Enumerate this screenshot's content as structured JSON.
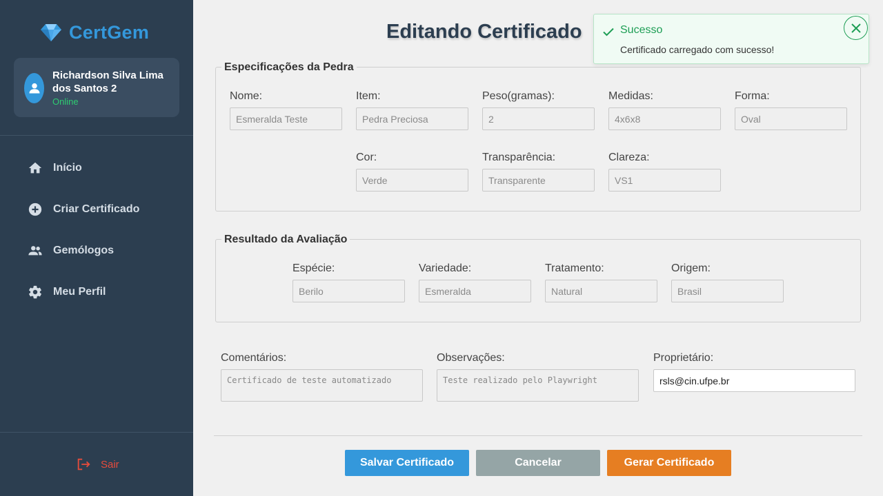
{
  "app": {
    "brand": "CertGem",
    "brand_icon": "gem-icon"
  },
  "user": {
    "name": "Richardson Silva Lima dos Santos 2",
    "status": "Online"
  },
  "nav": [
    {
      "label": "Início",
      "icon": "home-icon"
    },
    {
      "label": "Criar Certificado",
      "icon": "plus-circle-icon"
    },
    {
      "label": "Gemólogos",
      "icon": "people-icon"
    },
    {
      "label": "Meu Perfil",
      "icon": "gear-icon"
    }
  ],
  "logout": {
    "label": "Sair",
    "icon": "logout-icon"
  },
  "page": {
    "title": "Editando Certificado"
  },
  "stone": {
    "legend": "Especificações da Pedra",
    "fields": [
      {
        "label": "Nome:",
        "value": "Esmeralda Teste"
      },
      {
        "label": "Item:",
        "value": "Pedra Preciosa"
      },
      {
        "label": "Peso(gramas):",
        "value": "2"
      },
      {
        "label": "Medidas:",
        "value": "4x6x8"
      },
      {
        "label": "Forma:",
        "value": "Oval"
      },
      {
        "label": "Cor:",
        "value": "Verde"
      },
      {
        "label": "Transparência:",
        "value": "Transparente"
      },
      {
        "label": "Clareza:",
        "value": "VS1"
      }
    ]
  },
  "result": {
    "legend": "Resultado da Avaliação",
    "fields": [
      {
        "label": "Espécie:",
        "value": "Berilo"
      },
      {
        "label": "Variedade:",
        "value": "Esmeralda"
      },
      {
        "label": "Tratamento:",
        "value": "Natural"
      },
      {
        "label": "Origem:",
        "value": "Brasil"
      }
    ]
  },
  "extra": {
    "comments": {
      "label": "Comentários:",
      "value": "Certificado de teste automatizado"
    },
    "observations": {
      "label": "Observações:",
      "value": "Teste realizado pelo Playwright"
    },
    "owner": {
      "label": "Proprietário:",
      "value": "rsls@cin.ufpe.br"
    }
  },
  "actions": {
    "save": "Salvar Certificado",
    "cancel": "Cancelar",
    "generate": "Gerar Certificado"
  },
  "toast": {
    "title": "Sucesso",
    "message": "Certificado carregado com sucesso!",
    "icon": "check-icon",
    "close_icon": "close-icon"
  },
  "colors": {
    "sidebar": "#2c3e50",
    "brand": "#3498db",
    "online": "#2ecc71",
    "logout": "#e74c3c",
    "save": "#3498db",
    "cancel": "#95a5a6",
    "generate": "#e67e22",
    "success": "#1e9e55"
  }
}
